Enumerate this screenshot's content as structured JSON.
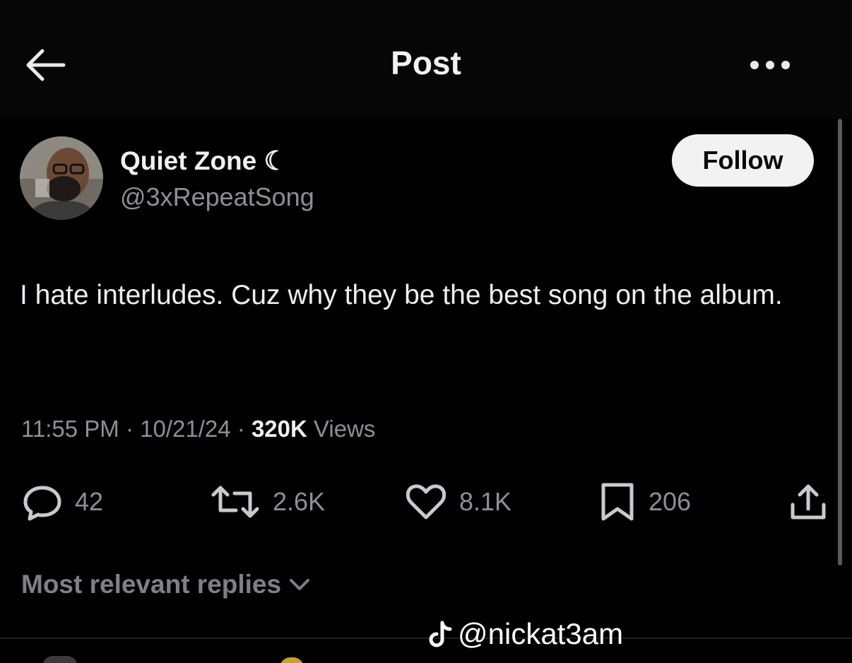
{
  "header": {
    "title": "Post"
  },
  "post": {
    "author": {
      "display_name": "Quiet Zone ☾",
      "handle": "@3xRepeatSong"
    },
    "follow_label": "Follow",
    "text": "I hate interludes. Cuz why they be the best song on the album.",
    "meta": {
      "time": "11:55 PM",
      "separator1": " · ",
      "date": "10/21/24",
      "separator2": " · ",
      "views_count": "320K",
      "views_label": " Views"
    },
    "actions": {
      "replies": "42",
      "reposts": "2.6K",
      "likes": "8.1K",
      "bookmarks": "206"
    }
  },
  "replies_sort": {
    "label": "Most relevant replies"
  },
  "watermark": {
    "text": "@nickat3am"
  },
  "icons": [
    "back-arrow-icon",
    "more-icon",
    "reply-icon",
    "repost-icon",
    "like-icon",
    "bookmark-icon",
    "share-icon",
    "chevron-down-icon",
    "tiktok-icon"
  ]
}
